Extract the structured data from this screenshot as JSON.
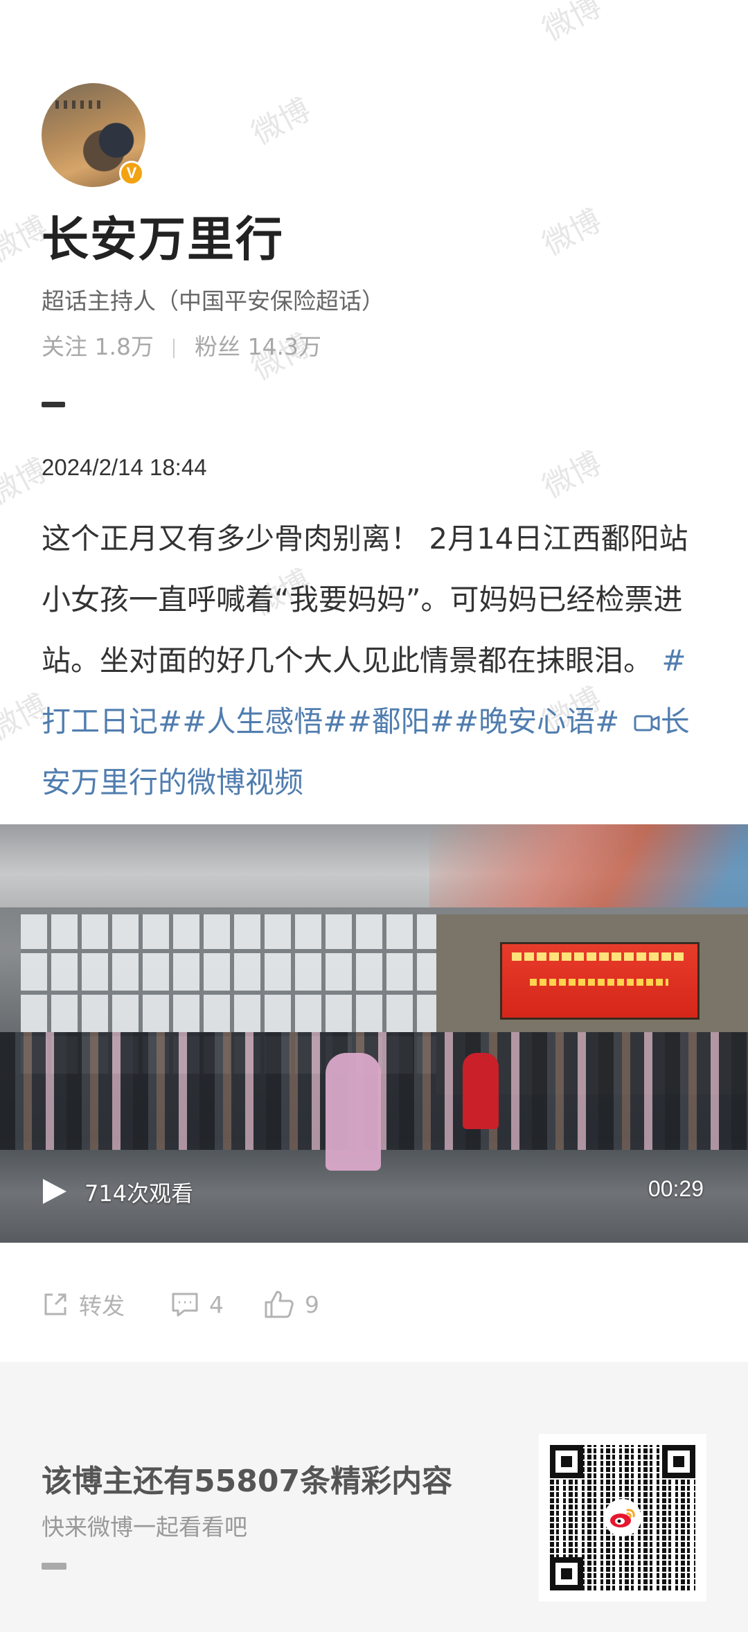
{
  "watermark": "微博",
  "profile": {
    "name": "长安万里行",
    "verified_mark": "V",
    "subtitle": "超话主持人（中国平安保险超话）",
    "following_label": "关注",
    "following_count": "1.8万",
    "followers_label": "粉丝",
    "followers_count": "14.3万"
  },
  "post": {
    "date": "2024/2/14 18:44",
    "text": "这个正月又有多少骨肉别离！ 2月14日江西鄱阳站 小女孩一直呼喊着“我要妈妈”。可妈妈已经检票进站。坐对面的好几个大人见此情景都在抹眼泪。",
    "hashtags": "#打工日记##人生感悟##鄱阳##晚安心语#",
    "video_link": "长安万里行的微博视频"
  },
  "video": {
    "views": "714次观看",
    "duration": "00:29"
  },
  "actions": {
    "repost_label": "转发",
    "comment_count": "4",
    "like_count": "9"
  },
  "footer": {
    "title": "该博主还有55807条精彩内容",
    "subtitle": "快来微博一起看看吧"
  },
  "colors": {
    "link": "#507daf",
    "verified": "#f3a212",
    "weibo_red": "#e6162d"
  }
}
